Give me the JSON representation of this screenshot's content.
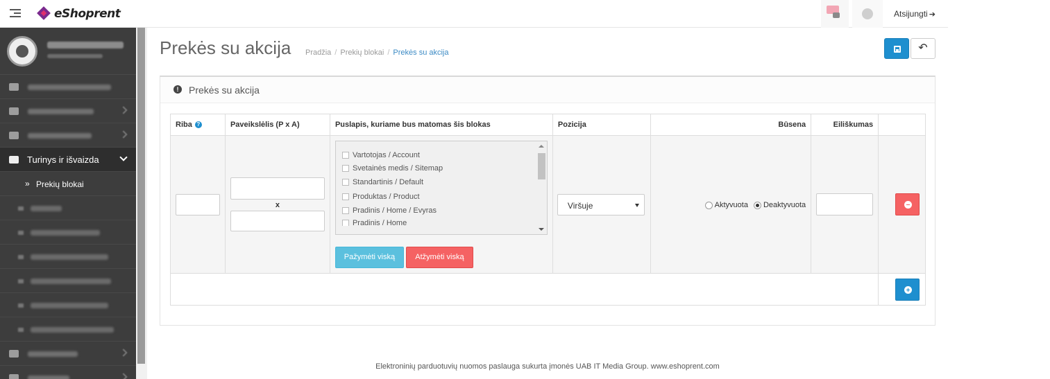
{
  "header": {
    "brand": "eShoprent",
    "logout_label": "Atsijungti"
  },
  "sidebar": {
    "active_section": "Turinys ir išvaizda",
    "current_subitem": "Prekių blokai"
  },
  "page": {
    "title": "Prekės su akcija",
    "breadcrumb": [
      "Pradžia",
      "Prekių blokai",
      "Prekės su akcija"
    ]
  },
  "panel": {
    "title": "Prekės su akcija",
    "columns": [
      "Riba",
      "Paveikslėlis (P x A)",
      "Puslapis, kuriame bus matomas šis blokas",
      "Pozicija",
      "Būsena",
      "Eiliškumas"
    ],
    "row": {
      "limit": "",
      "image_separator": "x",
      "pages": [
        "Vartotojas / Account",
        "Svetainės medis / Sitemap",
        "Standartinis / Default",
        "Produktas / Product",
        "Pradinis / Home / Evyras",
        "Pradinis / Home"
      ],
      "select_all_label": "Pažymėti viską",
      "deselect_all_label": "Atžymėti viską",
      "position": "Viršuje",
      "status_options": [
        "Aktyvuota",
        "Deaktyvuota"
      ],
      "status_selected": "Deaktyvuota",
      "sort_order": ""
    }
  },
  "footer": {
    "text": "Elektroninių parduotuvių nuomos paslauga sukurta įmonės UAB IT Media Group. www.eshoprent.com"
  },
  "colors": {
    "primary": "#1e8fcf",
    "danger": "#f56263",
    "info": "#5bc0de",
    "sidebar": "#3d3d3d"
  }
}
